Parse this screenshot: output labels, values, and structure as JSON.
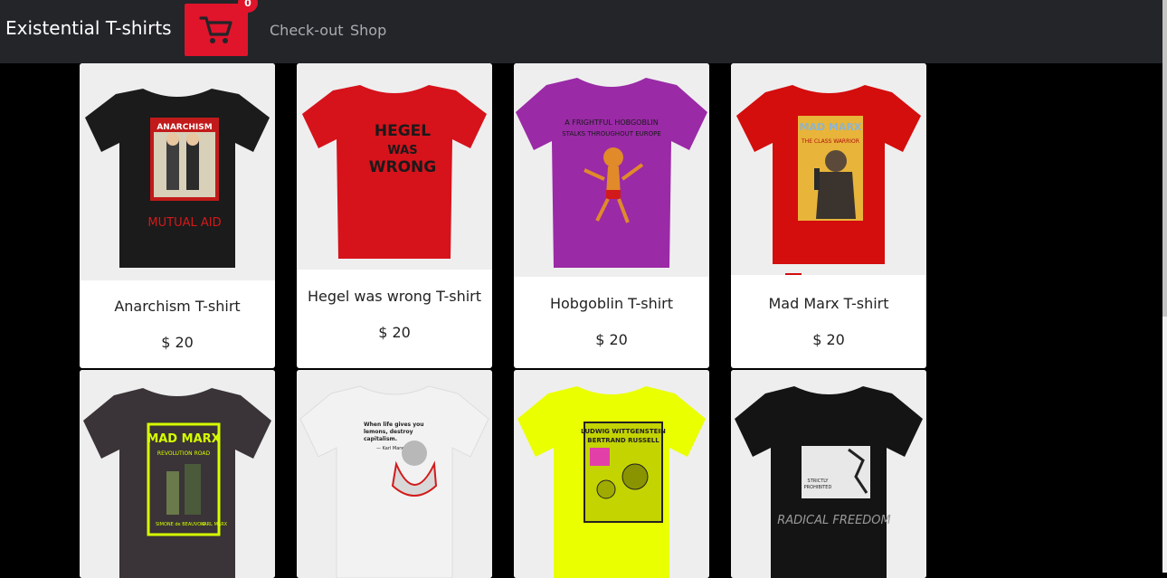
{
  "navbar": {
    "brand": "Existential T-shirts",
    "cart_count": "0",
    "links": [
      "Check-out",
      "Shop"
    ]
  },
  "products": [
    {
      "title": "Anarchism T-shirt",
      "price": "$ 20",
      "shirt_color": "#1b1b1b",
      "design": {
        "top": "ANARCHISM",
        "bottom": "MUTUAL AID"
      }
    },
    {
      "title": "Hegel was wrong T-shirt",
      "price": "$ 20",
      "shirt_color": "#d6121b",
      "design": {
        "lines": [
          "HEGEL",
          "WAS",
          "WRONG"
        ]
      }
    },
    {
      "title": "Hobgoblin T-shirt",
      "price": "$ 20",
      "shirt_color": "#9a2aa6",
      "design": {
        "lines": [
          "A FRIGHTFUL HOBGOBLIN",
          "STALKS THROUGHOUT EUROPE"
        ]
      }
    },
    {
      "title": "Mad Marx T-shirt",
      "price": "$ 20",
      "shirt_color": "#d40d0d",
      "design": {
        "top": "MAD MARX",
        "sub": "THE CLASS WARRIOR"
      }
    },
    {
      "title": "",
      "price": "",
      "shirt_color": "#3a3337",
      "design": {
        "top": "MAD MARX",
        "sub": "REVOLUTION ROAD",
        "left": "SIMONE de BEAUVOIR",
        "right": "KARL MARX"
      }
    },
    {
      "title": "",
      "price": "",
      "shirt_color": "#f2f2f2",
      "design": {
        "lines": [
          "When life gives you",
          "lemons, destroy",
          "capitalism."
        ],
        "credit": "— Karl Marx"
      }
    },
    {
      "title": "",
      "price": "",
      "shirt_color": "#eaff00",
      "design": {
        "top": "LUDWIG WITTGENSTEIN",
        "sub": "BERTRAND RUSSELL"
      }
    },
    {
      "title": "",
      "price": "",
      "shirt_color": "#141414",
      "design": {
        "lines": [
          "STRICTLY",
          "PROHIBITED"
        ],
        "bottom": "RADICAL FREEDOM"
      }
    }
  ]
}
